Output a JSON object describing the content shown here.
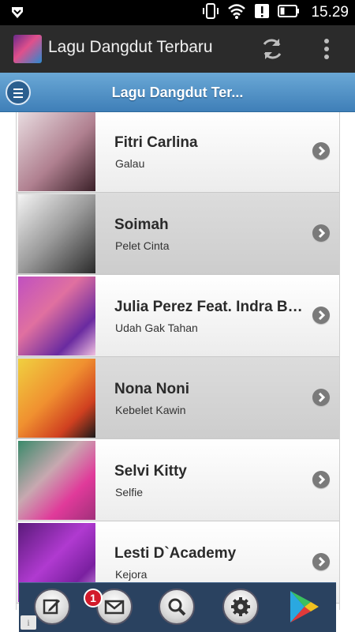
{
  "status_bar": {
    "time": "15.29",
    "icons": [
      "notification-shield-icon",
      "vibrate-icon",
      "wifi-icon",
      "alert-icon",
      "battery-icon"
    ]
  },
  "action_bar": {
    "title": "Lagu Dangdut Terbaru",
    "icons": [
      "app-icon",
      "refresh-icon",
      "overflow-menu-icon"
    ]
  },
  "header": {
    "title": "Lagu Dangdut Ter..."
  },
  "songs": [
    {
      "artist": "Fitri Carlina",
      "title": "Galau"
    },
    {
      "artist": "Soimah",
      "title": "Pelet Cinta"
    },
    {
      "artist": "Julia Perez Feat. Indra Bekti",
      "title": "Udah Gak Tahan"
    },
    {
      "artist": "Nona Noni",
      "title": "Kebelet Kawin"
    },
    {
      "artist": "Selvi Kitty",
      "title": "Selfie"
    },
    {
      "artist": "Lesti D`Academy",
      "title": "Kejora"
    }
  ],
  "bottom_bar": {
    "badge_count": "1",
    "info_label": "i",
    "icons": [
      "edit-icon",
      "mail-icon",
      "search-icon",
      "settings-icon",
      "play-store-icon"
    ]
  },
  "colors": {
    "header_blue": "#4a8ac4",
    "action_bar": "#2b2b2b",
    "bottom_bar": "#2a4260",
    "badge_red": "#d21a2a"
  }
}
